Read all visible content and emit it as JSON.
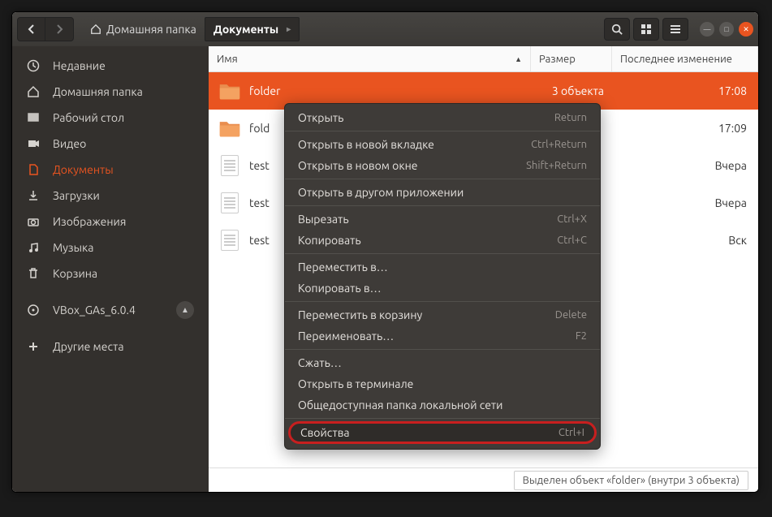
{
  "titlebar": {
    "breadcrumb": [
      {
        "label": "Домашняя папка",
        "icon": "home",
        "active": false
      },
      {
        "label": "Документы",
        "icon": null,
        "active": true
      }
    ]
  },
  "sidebar": {
    "items": [
      {
        "icon": "clock",
        "label": "Недавние",
        "active": false
      },
      {
        "icon": "home",
        "label": "Домашняя папка",
        "active": false
      },
      {
        "icon": "desktop",
        "label": "Рабочий стол",
        "active": false
      },
      {
        "icon": "video",
        "label": "Видео",
        "active": false
      },
      {
        "icon": "docs",
        "label": "Документы",
        "active": true
      },
      {
        "icon": "download",
        "label": "Загрузки",
        "active": false
      },
      {
        "icon": "camera",
        "label": "Изображения",
        "active": false
      },
      {
        "icon": "music",
        "label": "Музыка",
        "active": false
      },
      {
        "icon": "trash",
        "label": "Корзина",
        "active": false
      }
    ],
    "volumes": [
      {
        "icon": "disc",
        "label": "VBox_GAs_6.0.4",
        "eject": true
      }
    ],
    "other": {
      "icon": "plus",
      "label": "Другие места"
    }
  },
  "columns": {
    "name": "Имя",
    "size": "Размер",
    "modified": "Последнее изменение"
  },
  "files": [
    {
      "type": "folder",
      "name": "folder",
      "size": "3 объекта",
      "modified": "17:08",
      "selected": true
    },
    {
      "type": "folder",
      "name": "fold",
      "size": "",
      "modified": "17:09",
      "selected": false
    },
    {
      "type": "text",
      "name": "test",
      "size": "",
      "modified": "Вчера",
      "selected": false
    },
    {
      "type": "text",
      "name": "test",
      "size": "",
      "modified": "Вчера",
      "selected": false
    },
    {
      "type": "text",
      "name": "test",
      "size": "",
      "modified": "Вск",
      "selected": false
    }
  ],
  "context_menu": [
    {
      "label": "Открыть",
      "shortcut": "Return"
    },
    {
      "sep": true
    },
    {
      "label": "Открыть в новой вкладке",
      "shortcut": "Ctrl+Return"
    },
    {
      "label": "Открыть в новом окне",
      "shortcut": "Shift+Return"
    },
    {
      "sep": true
    },
    {
      "label": "Открыть в другом приложении",
      "shortcut": ""
    },
    {
      "sep": true
    },
    {
      "label": "Вырезать",
      "shortcut": "Ctrl+X"
    },
    {
      "label": "Копировать",
      "shortcut": "Ctrl+C"
    },
    {
      "sep": true
    },
    {
      "label": "Переместить в…",
      "shortcut": ""
    },
    {
      "label": "Копировать в…",
      "shortcut": ""
    },
    {
      "sep": true
    },
    {
      "label": "Переместить в корзину",
      "shortcut": "Delete"
    },
    {
      "label": "Переименовать…",
      "shortcut": "F2"
    },
    {
      "sep": true
    },
    {
      "label": "Сжать…",
      "shortcut": ""
    },
    {
      "label": "Открыть в терминале",
      "shortcut": ""
    },
    {
      "label": "Общедоступная папка локальной сети",
      "shortcut": ""
    },
    {
      "sep": true
    },
    {
      "label": "Свойства",
      "shortcut": "Ctrl+I",
      "highlighted": true
    }
  ],
  "statusbar": {
    "text": "Выделен объект «folder»  (внутри 3 объекта)"
  }
}
